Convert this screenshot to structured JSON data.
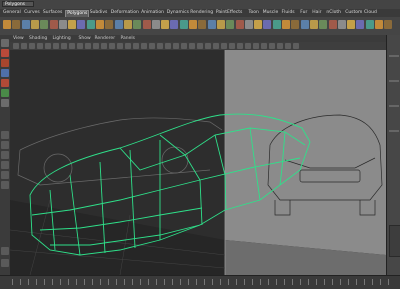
{
  "title_bar": {
    "mode_select": "Polygons"
  },
  "shelf_tabs": [
    {
      "label": "General",
      "active": false
    },
    {
      "label": "Curves",
      "active": false
    },
    {
      "label": "Surfaces",
      "active": false
    },
    {
      "label": "Polygons",
      "active": true
    },
    {
      "label": "Subdivs",
      "active": false
    },
    {
      "label": "Deformation",
      "active": false
    },
    {
      "label": "Animation",
      "active": false
    },
    {
      "label": "Dynamics",
      "active": false
    },
    {
      "label": "Rendering",
      "active": false
    },
    {
      "label": "PaintEffects",
      "active": false
    },
    {
      "label": "Toon",
      "active": false
    },
    {
      "label": "Muscle",
      "active": false
    },
    {
      "label": "Fluids",
      "active": false
    },
    {
      "label": "Fur",
      "active": false
    },
    {
      "label": "Hair",
      "active": false
    },
    {
      "label": "nCloth",
      "active": false
    },
    {
      "label": "Custom",
      "active": false
    },
    {
      "label": "Cloud",
      "active": false
    }
  ],
  "viewport_menu": [
    "View",
    "Shading",
    "Lighting",
    "Show",
    "Renderer",
    "Panels"
  ],
  "colors": {
    "wireframe_selected": "#2fe08a",
    "accent_tab": "#5d5d5d",
    "viewport_bg": "#2f2f2f",
    "image_plane_side": "#8a8a8a"
  }
}
